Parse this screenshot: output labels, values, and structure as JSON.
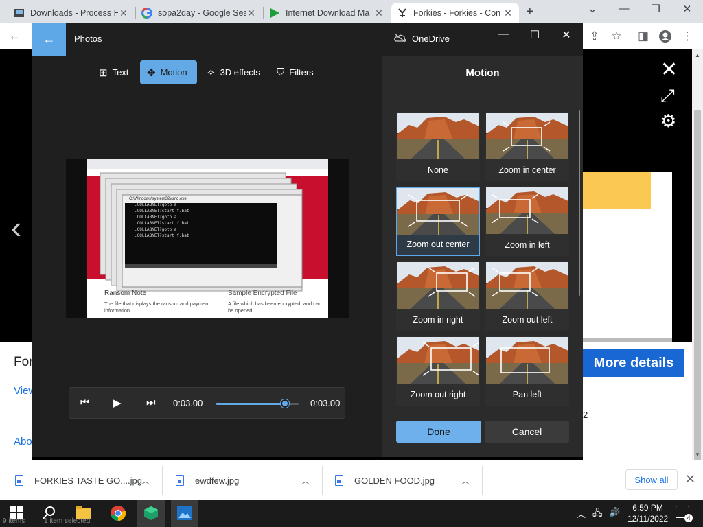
{
  "browser": {
    "tabs": [
      {
        "title": "Downloads - Process H",
        "icon": "process-hacker-icon"
      },
      {
        "title": "sopa2day - Google Sea",
        "icon": "google-icon"
      },
      {
        "title": "Internet Download Ma",
        "icon": "idm-icon"
      },
      {
        "title": "Forkies - Forkies - Con",
        "icon": "forkies-icon"
      }
    ],
    "active_tab": 3
  },
  "page": {
    "left_text_1": "For",
    "left_text_2": "View",
    "left_text_3": "Abou",
    "more_details": "More details",
    "page_num": "2"
  },
  "photos": {
    "title": "Photos",
    "onedrive": "OneDrive",
    "edit_tools": [
      {
        "label": "Text",
        "icon": "text-add-icon"
      },
      {
        "label": "Motion",
        "icon": "motion-icon",
        "active": true
      },
      {
        "label": "3D effects",
        "icon": "3d-effects-icon"
      },
      {
        "label": "Filters",
        "icon": "filters-icon"
      }
    ],
    "playback": {
      "current": "0:03.00",
      "total": "0:03.00",
      "progress": 0.83
    },
    "preview": {
      "cmd_title": "C:\\Windows\\system32\\cmd.exe",
      "cmd_lines": [
        ".COLLABNET?goto a",
        ".COLLABNET?start f.bat",
        ".COLLABNET?goto a",
        ".COLLABNET?start f.bat",
        ".COLLABNET?goto a",
        ".COLLABNET?start f.bat"
      ],
      "ransom_title": "Ransom Note",
      "ransom_desc": "The file that displays the ransom and payment information.",
      "sample_title": "Sample Encrypted File",
      "sample_desc": "A file which has been encrypted, and can be opened."
    },
    "motion_panel": {
      "title": "Motion",
      "options": [
        {
          "label": "None"
        },
        {
          "label": "Zoom in center"
        },
        {
          "label": "Zoom out center",
          "selected": true
        },
        {
          "label": "Zoom in left"
        },
        {
          "label": "Zoom in right"
        },
        {
          "label": "Zoom out left"
        },
        {
          "label": "Zoom out right"
        },
        {
          "label": "Pan left"
        }
      ],
      "done": "Done",
      "cancel": "Cancel"
    }
  },
  "downloads": {
    "items": [
      "FORKIES TASTE GO....jpg",
      "ewdfew.jpg",
      "GOLDEN FOOD.jpg"
    ],
    "show_all": "Show all"
  },
  "taskbar": {
    "time": "6:59 PM",
    "date": "12/11/2022",
    "notifications": "4",
    "status_left": "9 items",
    "status_mid": "1 item selected"
  },
  "colors": {
    "accent": "#5fa8e8",
    "more_details_bg": "#1967d2",
    "yellow": "#fbc952"
  }
}
